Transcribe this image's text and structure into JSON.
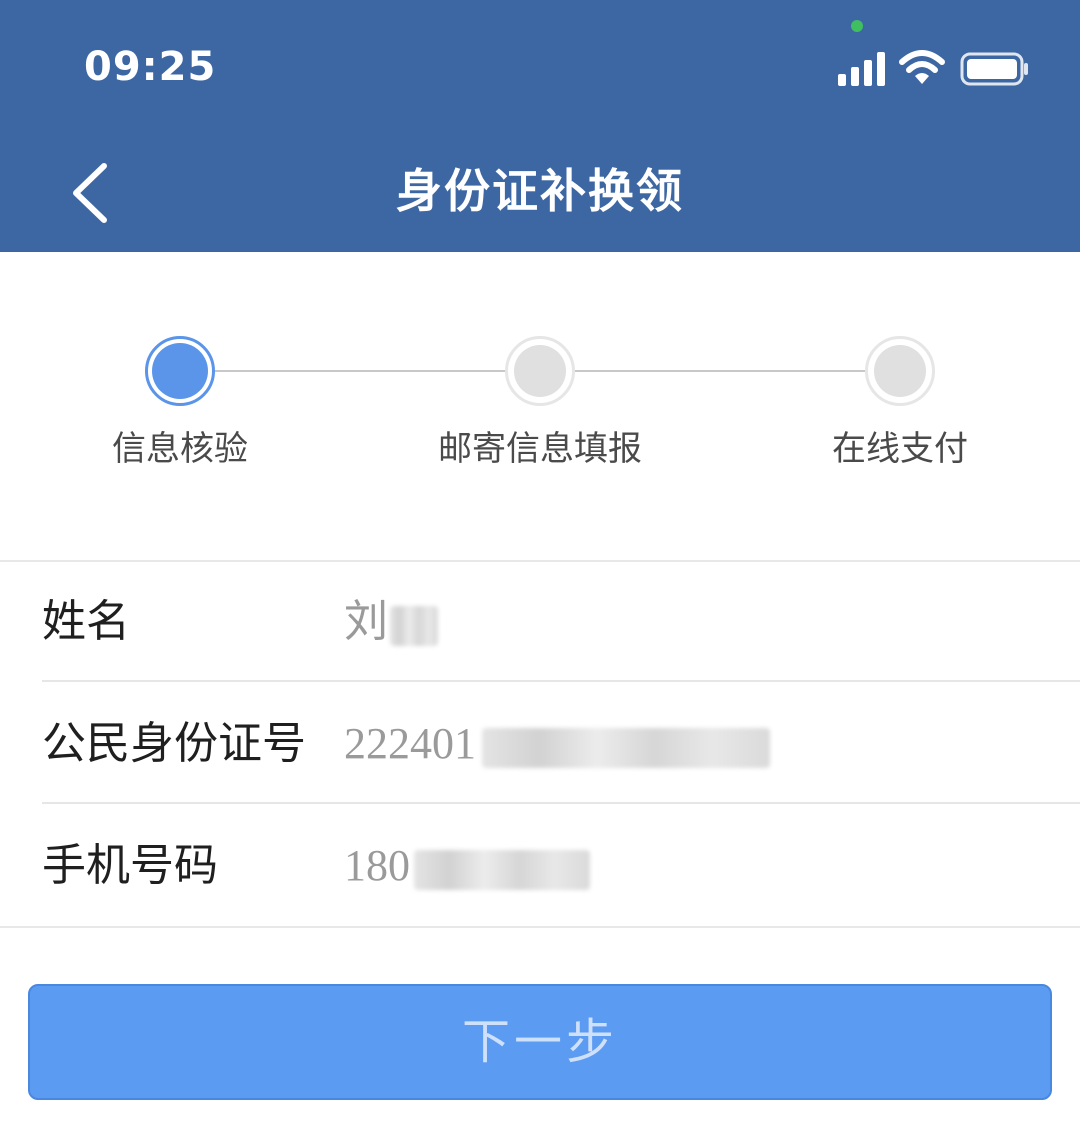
{
  "status_bar": {
    "time": "09:25",
    "icons": [
      "signal-icon",
      "wifi-icon",
      "battery-icon"
    ]
  },
  "nav": {
    "title": "身份证补换领",
    "back_icon": "chevron-left-icon"
  },
  "steps": [
    {
      "label": "信息核验",
      "state": "active"
    },
    {
      "label": "邮寄信息填报",
      "state": "pending"
    },
    {
      "label": "在线支付",
      "state": "pending"
    }
  ],
  "form": {
    "name_label": "姓名",
    "name_value": "刘",
    "id_label": "公民身份证号",
    "id_value": "222401",
    "phone_label": "手机号码",
    "phone_value": "180"
  },
  "next_button_label": "下一步",
  "colors": {
    "header_bg": "#3d67a3",
    "accent": "#5b95ea",
    "button_bg": "#5b9bf2",
    "camera_dot": "#3fbf5f"
  }
}
